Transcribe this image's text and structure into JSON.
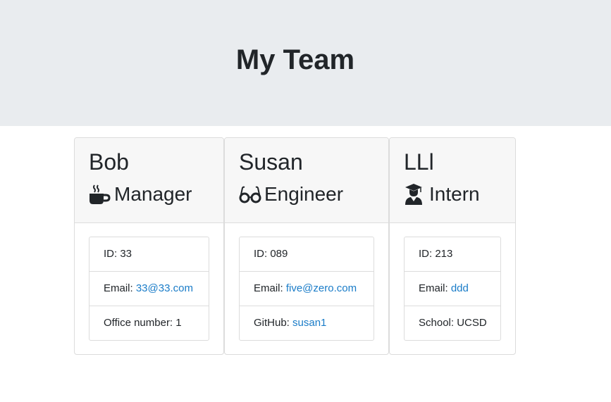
{
  "header": {
    "title": "My Team"
  },
  "colors": {
    "jumbotron_bg": "#e9ecef",
    "card_header_bg": "#f7f7f7",
    "link": "#1a7cc8",
    "text": "#212529"
  },
  "members": [
    {
      "name": "Bob",
      "role": "Manager",
      "icon": "coffee-mug-icon",
      "id_text": "ID: 33",
      "email_prefix": "Email: ",
      "email": "33@33.com",
      "extra_text": "Office number: 1"
    },
    {
      "name": "Susan",
      "role": "Engineer",
      "icon": "glasses-icon",
      "id_text": "ID: 089",
      "email_prefix": "Email: ",
      "email": "five@zero.com",
      "extra_prefix": "GitHub: ",
      "extra_link": "susan1"
    },
    {
      "name": "LLl",
      "role": "Intern",
      "icon": "graduate-icon",
      "id_text": "ID: 213",
      "email_prefix": "Email: ",
      "email": "ddd",
      "extra_text": "School: UCSD"
    }
  ]
}
